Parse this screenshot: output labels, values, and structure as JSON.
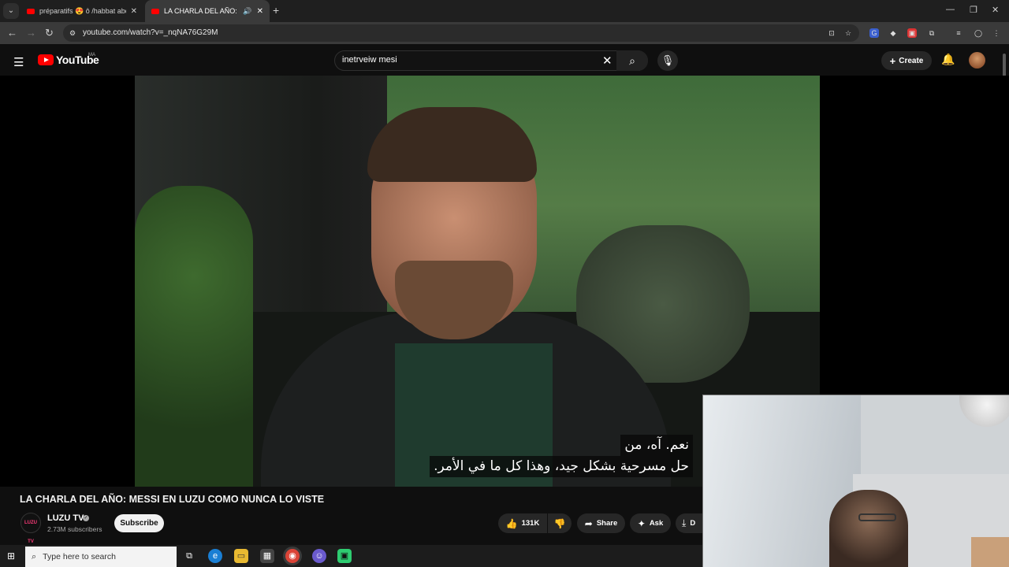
{
  "browser": {
    "tabs": [
      {
        "title": "préparatifs 😍 ô /habbat abdel",
        "active": false
      },
      {
        "title": "LA CHARLA DEL AÑO: MESSI",
        "active": true
      }
    ],
    "url": "youtube.com/watch?v=_nqNA76G29M"
  },
  "youtube": {
    "logo_text": "YouTube",
    "country_code": "MA",
    "search_query": "inetrveiw mesi",
    "create_label": "Create"
  },
  "video": {
    "subtitle_lines": [
      "نعم. آه، من",
      "حل مسرحية بشكل جيد، وهذا كل ما في الأمر."
    ],
    "title": "LA CHARLA DEL AÑO: MESSI EN LUZU COMO NUNCA LO VISTE"
  },
  "channel": {
    "avatar_text": "LUZU TV",
    "name": "LUZU TV",
    "subscribers": "2.73M subscribers",
    "subscribe_label": "Subscribe"
  },
  "actions": {
    "likes": "131K",
    "share_label": "Share",
    "ask_label": "Ask",
    "download_label": "D"
  },
  "taskbar": {
    "search_placeholder": "Type here to search"
  },
  "colors": {
    "accent": "#ff0000",
    "background": "#0f0f0f"
  }
}
